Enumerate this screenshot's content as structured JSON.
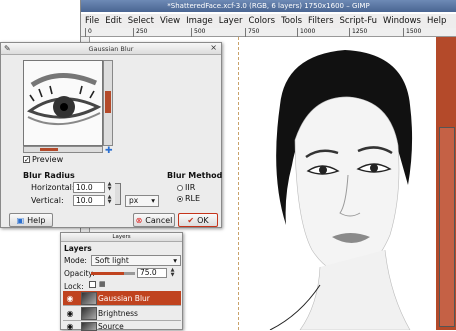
{
  "main_window": {
    "title": "*ShatteredFace.xcf-3.0 (RGB, 6 layers) 1750x1600 – GIMP",
    "menu": [
      "File",
      "Edit",
      "Select",
      "View",
      "Image",
      "Layer",
      "Colors",
      "Tools",
      "Filters",
      "Script-Fu",
      "Windows",
      "Help"
    ],
    "ruler_ticks": [
      "0",
      "250",
      "500",
      "750",
      "1000",
      "1250",
      "1500"
    ]
  },
  "blur_dialog": {
    "title": "Gaussian Blur",
    "preview_label": "Preview",
    "preview_checked": true,
    "radius_heading": "Blur Radius",
    "horizontal_label": "Horizontal:",
    "horizontal_value": "10.0",
    "vertical_label": "Vertical:",
    "vertical_value": "10.0",
    "unit": "px",
    "method_heading": "Blur Method",
    "methods": [
      "IIR",
      "RLE"
    ],
    "selected_method": "RLE",
    "help_label": "Help",
    "cancel_label": "Cancel",
    "ok_label": "OK"
  },
  "layers_dock": {
    "title": "Layers",
    "heading": "Layers",
    "mode_label": "Mode:",
    "mode_value": "Soft light",
    "opacity_label": "Opacity:",
    "opacity_value": "75.0",
    "opacity_fraction": 0.75,
    "lock_label": "Lock:",
    "layers": [
      {
        "name": "Gaussian Blur",
        "active": true
      },
      {
        "name": "Brightness",
        "active": false
      },
      {
        "name": "Source",
        "active": false
      }
    ]
  },
  "colors": {
    "accent": "#b44a2a",
    "titlebar": "#5a76a3"
  },
  "icons": [
    "gimp-icon",
    "help-icon",
    "cancel-icon",
    "ok-icon",
    "eye-icon",
    "chain-icon",
    "close-icon"
  ]
}
